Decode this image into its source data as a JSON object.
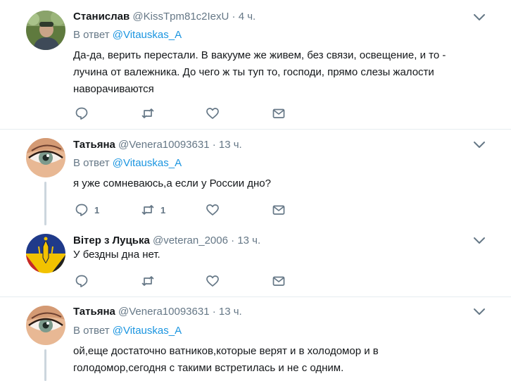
{
  "tweets": [
    {
      "name": "Станислав",
      "handle": "@KissTpm81c2IexU",
      "time": "4 ч.",
      "reply_prefix": "В ответ ",
      "reply_to": "@Vitauskas_A",
      "text": "Да-да, верить перестали. В вакууме же живем, без связи, освещение, и то - лучина от валежника. До чего ж ты туп то, господи, прямо слезы жалости наворачиваются",
      "reply_count": "",
      "retweet_count": ""
    },
    {
      "name": "Татьяна",
      "handle": "@Venera10093631",
      "time": "13 ч.",
      "reply_prefix": "В ответ ",
      "reply_to": "@Vitauskas_A",
      "text": "я уже сомневаюсь,а если у России дно?",
      "reply_count": "1",
      "retweet_count": "1"
    },
    {
      "name": "Вітер з Луцька",
      "handle": "@veteran_2006",
      "time": "13 ч.",
      "text": "У бездны дна нет.",
      "reply_count": "",
      "retweet_count": ""
    },
    {
      "name": "Татьяна",
      "handle": "@Venera10093631",
      "time": "13 ч.",
      "reply_prefix": "В ответ ",
      "reply_to": "@Vitauskas_A",
      "text": "ой,еще достаточно ватников,которые верят и в холодомор и в голодомор,сегодня с такими встретилась и не с одним."
    }
  ],
  "separator": "·",
  "colors": {
    "link": "#1b95e0",
    "secondary": "#657786",
    "border": "#e6ecf0",
    "thread": "#ccd6dd"
  }
}
